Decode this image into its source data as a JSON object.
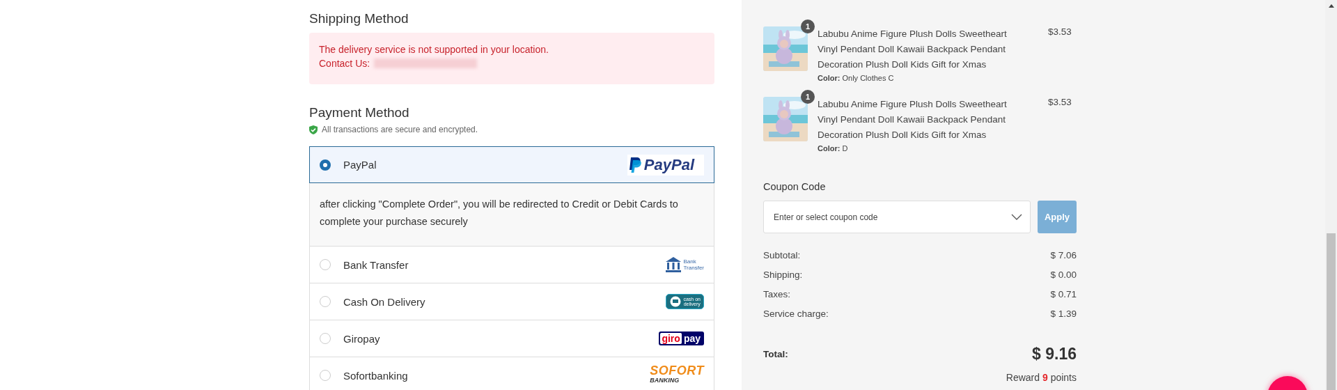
{
  "shipping": {
    "title": "Shipping Method",
    "alert": {
      "message": "The delivery service is not supported in your location.",
      "contact_label": "Contact Us:"
    }
  },
  "payment": {
    "title": "Payment Method",
    "secure_note": "All transactions are secure and encrypted.",
    "options": [
      {
        "kind": "paypal",
        "label": "PayPal",
        "selected": true,
        "logo": [
          "PayPal"
        ],
        "description": "after clicking \"Complete Order\", you will be redirected to Credit or Debit Cards to complete your purchase securely"
      },
      {
        "kind": "bank",
        "label": "Bank Transfer",
        "selected": false,
        "logo": [
          "Bank",
          "Transfer"
        ]
      },
      {
        "kind": "cod",
        "label": "Cash On Delivery",
        "selected": false,
        "logo": [
          "cash on",
          "delivery"
        ]
      },
      {
        "kind": "giropay",
        "label": "Giropay",
        "selected": false,
        "logo": [
          "giro",
          "pay"
        ]
      },
      {
        "kind": "sofort",
        "label": "Sofortbanking",
        "selected": false,
        "logo": [
          "SOFORT",
          "BANKING"
        ]
      }
    ]
  },
  "order": {
    "items": [
      {
        "quantity": "1",
        "name": "Labubu Anime Figure Plush Dolls Sweetheart Vinyl Pendant Doll Kawaii Backpack Pendant Decoration Plush Doll Kids Gift for Xmas",
        "option_label": "Color:",
        "option_value": "Only Clothes C",
        "price": "$3.53"
      },
      {
        "quantity": "1",
        "name": "Labubu Anime Figure Plush Dolls Sweetheart Vinyl Pendant Doll Kawaii Backpack Pendant Decoration Plush Doll Kids Gift for Xmas",
        "option_label": "Color:",
        "option_value": "D",
        "price": "$3.53"
      }
    ],
    "coupon": {
      "label": "Coupon Code",
      "placeholder": "Enter or select coupon code",
      "button": "Apply"
    },
    "summary": [
      {
        "label": "Subtotal:",
        "value": "$ 7.06"
      },
      {
        "label": "Shipping:",
        "value": "$ 0.00"
      },
      {
        "label": "Taxes:",
        "value": "$ 0.71"
      },
      {
        "label": "Service charge:",
        "value": "$ 1.39"
      }
    ],
    "total": {
      "label": "Total:",
      "value": "$ 9.16"
    },
    "reward": {
      "before": "Reward",
      "points": "9",
      "after": "points"
    }
  }
}
